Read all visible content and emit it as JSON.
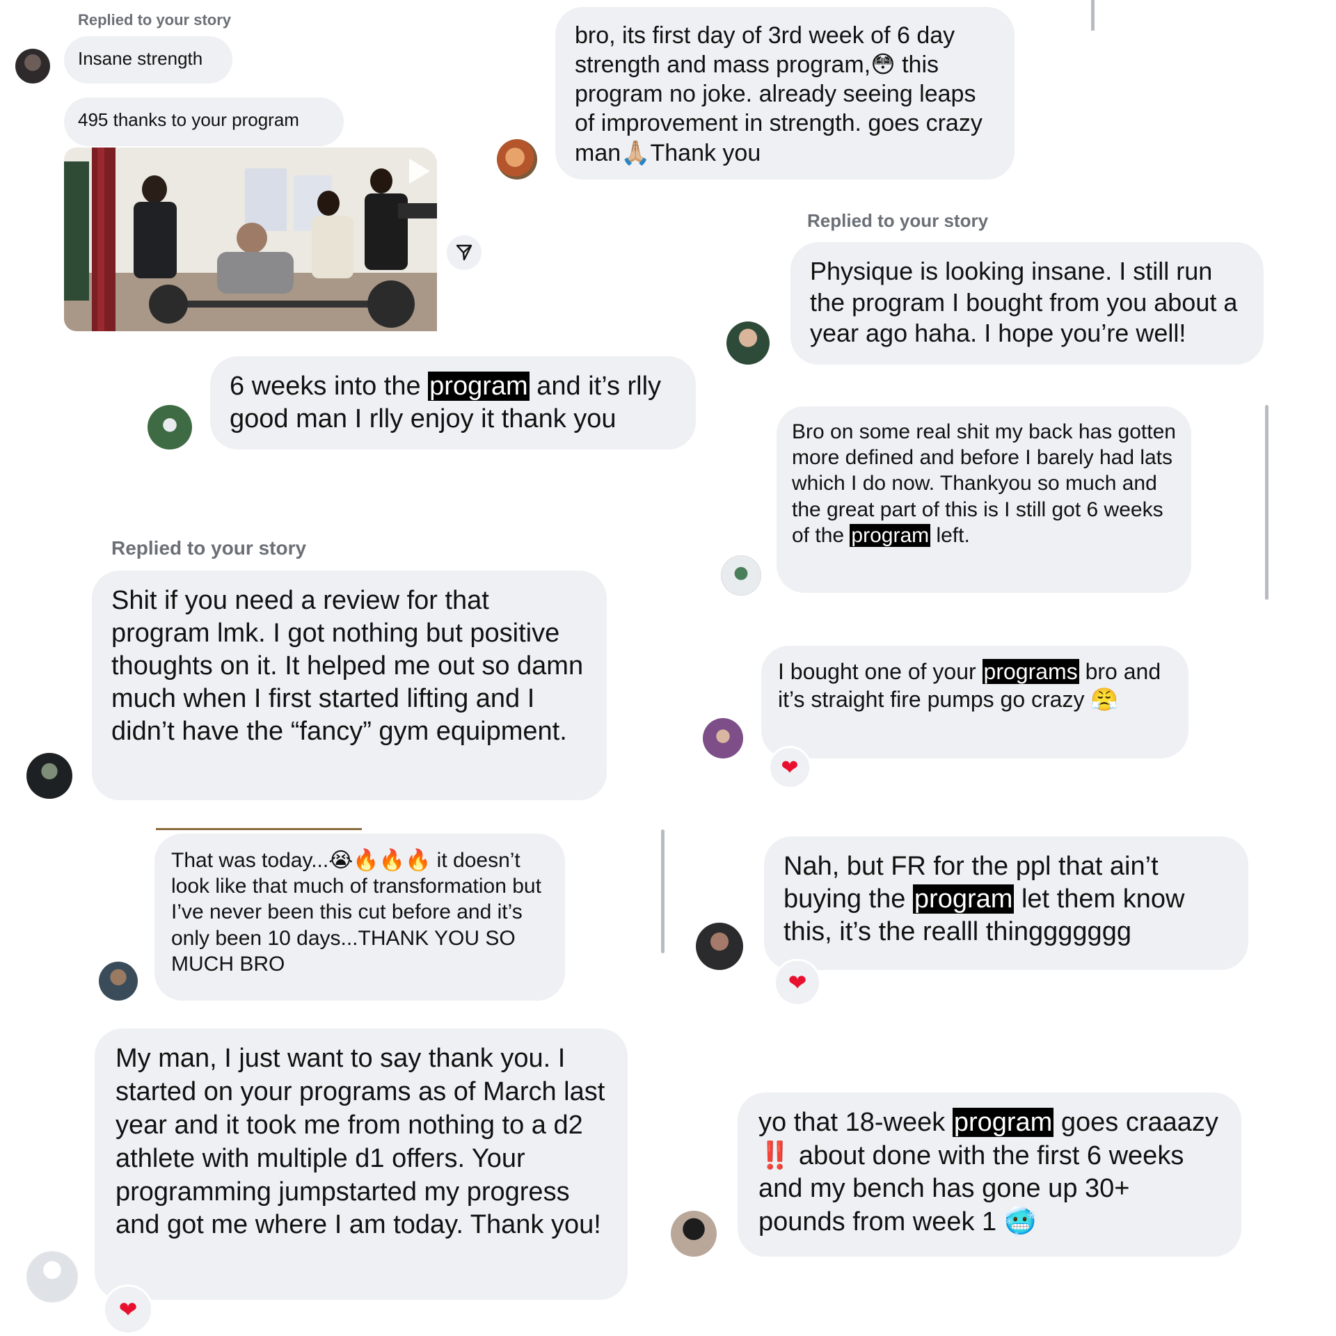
{
  "story_reply_label": "Replied to your story",
  "messages": {
    "m1_header": "Replied to your story",
    "m1_text": "Insane strength",
    "m2_text": "495 thanks to your program",
    "m3_text_a": "bro, its first day of 3rd week of 6 day strength and mass program,",
    "m3_emoji_a": "😳",
    "m3_text_b": " this program no joke. already seeing leaps of improvement in strength. goes crazy man",
    "m3_emoji_b": "🙏🏼",
    "m3_text_c": "Thank you",
    "m4_header": "Replied to your story",
    "m4_text": "Physique is looking insane. I still run the program I bought from you about a year ago haha. I hope you’re well!",
    "m5_text_a": "6 weeks into the ",
    "m5_hl": "program",
    "m5_text_b": " and it’s rlly good man I rlly enjoy it thank you",
    "m6_text_a": "Bro on some real shit my back has gotten more defined and before I barely had lats which I do now. Thankyou so much and the great part of this is I still got 6 weeks of the ",
    "m6_hl": "program",
    "m6_text_b": " left.",
    "m7_header": "Replied to your story",
    "m7_text": "Shit if you need a review for that program lmk. I got nothing but positive thoughts on it. It helped me out so damn much when I first started lifting and I didn’t have the “fancy” gym equipment.",
    "m8_text_a": "I bought one of your ",
    "m8_hl": "programs",
    "m8_text_b": " bro and it’s straight fire pumps go crazy ",
    "m8_emoji": "😤",
    "m9_text_a": "That was today...",
    "m9_emoji": "😭🔥🔥🔥",
    "m9_text_b": " it doesn’t look like that much of transformation but I’ve never been this cut before and it’s only been 10 days...THANK YOU SO MUCH BRO",
    "m10_text_a": "Nah, but FR for the ppl that ain’t buying the ",
    "m10_hl": "program",
    "m10_text_b": " let them know this, it’s the realll thinggggggg",
    "m11_text": "My man, I just want to say thank you. I started on your programs as of March last year and it took me from nothing to a d2 athlete with multiple d1 offers. Your programming jumpstarted my progress and got me where I am today. Thank you!",
    "m12_text_a": "yo that 18-week ",
    "m12_hl": "program",
    "m12_text_b": " goes craaazy ",
    "m12_emoji_a": "‼️",
    "m12_text_c": " about done with the first 6 weeks and my bench has gone up 30+ pounds from week 1 ",
    "m12_emoji_b": "🥶"
  },
  "reaction_heart": "❤",
  "share_icon": "paper-plane-icon",
  "colors": {
    "bubble": "#eef0f3",
    "highlight": "#000000",
    "label": "#6b6f76",
    "heart": "#e8102e"
  }
}
